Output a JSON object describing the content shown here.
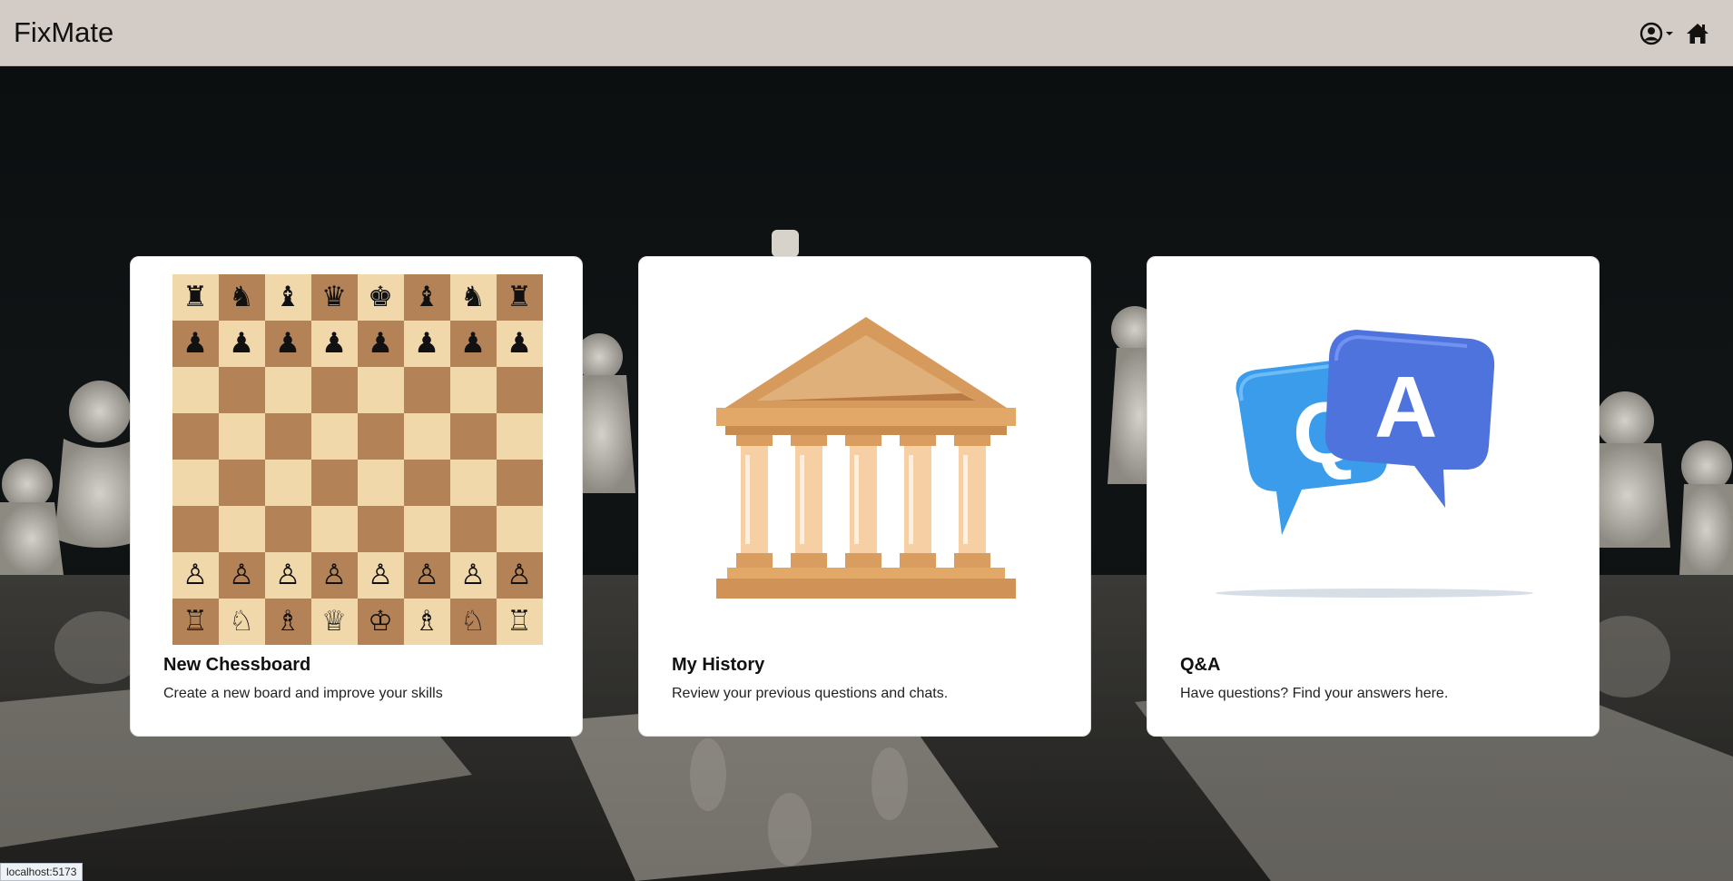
{
  "app": {
    "title": "FixMate"
  },
  "header": {
    "user_icon": "user-circle-icon",
    "home_icon": "home-icon"
  },
  "cards": [
    {
      "title": "New Chessboard",
      "description": "Create a new board and improve your skills",
      "art": "chessboard"
    },
    {
      "title": "My History",
      "description": "Review your previous questions and chats.",
      "art": "temple-icon"
    },
    {
      "title": "Q&A",
      "description": "Have questions? Find your answers here.",
      "art": "qa-bubbles-icon"
    }
  ],
  "qa_art": {
    "q_letter": "Q",
    "a_letter": "A"
  },
  "chessboard": {
    "ranks": [
      [
        "♜",
        "♞",
        "♝",
        "♛",
        "♚",
        "♝",
        "♞",
        "♜"
      ],
      [
        "♟",
        "♟",
        "♟",
        "♟",
        "♟",
        "♟",
        "♟",
        "♟"
      ],
      [
        "",
        "",
        "",
        "",
        "",
        "",
        "",
        ""
      ],
      [
        "",
        "",
        "",
        "",
        "",
        "",
        "",
        ""
      ],
      [
        "",
        "",
        "",
        "",
        "",
        "",
        "",
        ""
      ],
      [
        "",
        "",
        "",
        "",
        "",
        "",
        "",
        ""
      ],
      [
        "♙",
        "♙",
        "♙",
        "♙",
        "♙",
        "♙",
        "♙",
        "♙"
      ],
      [
        "♖",
        "♘",
        "♗",
        "♕",
        "♔",
        "♗",
        "♘",
        "♖"
      ]
    ]
  },
  "status_bar": {
    "url": "localhost:5173"
  },
  "colors": {
    "header_bg": "#d3cbc6",
    "light_square": "#f0d8ab",
    "dark_square": "#b38257"
  }
}
